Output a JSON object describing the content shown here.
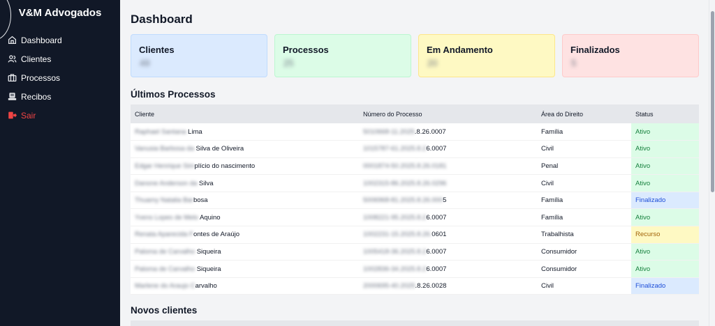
{
  "sidebar": {
    "brand": "V&M Advogados",
    "items": [
      {
        "label": "Dashboard",
        "icon": "home-icon"
      },
      {
        "label": "Clientes",
        "icon": "users-icon"
      },
      {
        "label": "Processos",
        "icon": "briefcase-icon"
      },
      {
        "label": "Recibos",
        "icon": "receipt-icon"
      },
      {
        "label": "Sair",
        "icon": "logout-icon"
      }
    ]
  },
  "main": {
    "title": "Dashboard",
    "cards": [
      {
        "label": "Clientes",
        "value": "49"
      },
      {
        "label": "Processos",
        "value": "25"
      },
      {
        "label": "Em Andamento",
        "value": "20"
      },
      {
        "label": "Finalizados",
        "value": "5"
      }
    ],
    "latest_title": "Últimos Processos",
    "new_clients_title": "Novos clientes",
    "table": {
      "headers": [
        "Cliente",
        "Número do Processo",
        "Área do Direito",
        "Status"
      ],
      "rows": [
        {
          "client_hidden": "Raphael Santana",
          "client_visible": " Lima",
          "num_hidden": "5010668-11.2025",
          "num_visible": ".8.26.0007",
          "area": "Família",
          "status": "Ativo"
        },
        {
          "client_hidden": "Vanusia Barbosa da",
          "client_visible": " Silva de Oliveira",
          "num_hidden": "1015787-61.2025.8.2",
          "num_visible": "6.0007",
          "area": "Civil",
          "status": "Ativo"
        },
        {
          "client_hidden": "Edgar Henrique Sim",
          "client_visible": "plício do nascimento",
          "num_hidden": "0001874-50.2025.8.26.0181",
          "num_visible": "",
          "area": "Penal",
          "status": "Ativo"
        },
        {
          "client_hidden": "Danone Anderson da",
          "client_visible": " Silva",
          "num_hidden": "1002315-86.2025.8.26.0296",
          "num_visible": "",
          "area": "Civil",
          "status": "Ativo"
        },
        {
          "client_hidden": "Thuamy Natalia Bar",
          "client_visible": "bosa",
          "num_hidden": "5006968-81.2025.8.26.000",
          "num_visible": "5",
          "area": "Família",
          "status": "Finalizado"
        },
        {
          "client_hidden": "Yvens Lopes de Melo",
          "client_visible": " Aquino",
          "num_hidden": "1008221-95.2025.8.2",
          "num_visible": "6.0007",
          "area": "Família",
          "status": "Ativo"
        },
        {
          "client_hidden": "Renata Aparecida F",
          "client_visible": "ontes de Araújo",
          "num_hidden": "1002231-15.2025.8.26.",
          "num_visible": "0601",
          "area": "Trabalhista",
          "status": "Recurso"
        },
        {
          "client_hidden": "Paloma de Carvalho",
          "client_visible": " Siqueira",
          "num_hidden": "1005418-36.2025.8.2",
          "num_visible": "6.0007",
          "area": "Consumidor",
          "status": "Ativo"
        },
        {
          "client_hidden": "Paloma de Carvalho ",
          "client_visible": "Siqueira",
          "num_hidden": "1002836-34.2025.8.2",
          "num_visible": "6.0007",
          "area": "Consumidor",
          "status": "Ativo"
        },
        {
          "client_hidden": "Marlene do Araujo C",
          "client_visible": "arvalho",
          "num_hidden": "2000695-40.2025",
          "num_visible": ".8.26.0028",
          "area": "Civil",
          "status": "Finalizado"
        }
      ]
    }
  },
  "colors": {
    "sidebar_bg": "#111827",
    "logout": "#ef4444",
    "ativo": "#15803d",
    "finalizado": "#1d4ed8",
    "recurso": "#a16207"
  }
}
